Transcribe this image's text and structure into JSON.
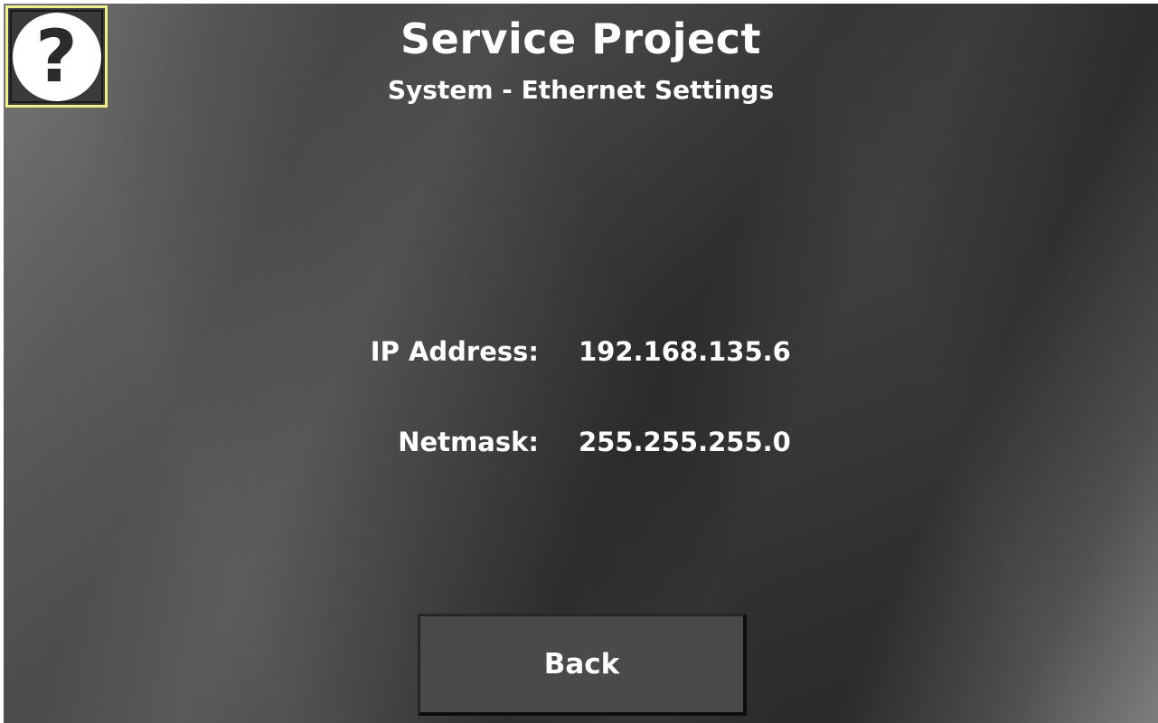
{
  "header": {
    "title": "Service Project",
    "subtitle": "System - Ethernet Settings"
  },
  "help_button": {
    "icon": "question-mark-icon",
    "glyph": "?"
  },
  "ethernet": {
    "ip_label": "IP Address:",
    "ip_value": "192.168.135.6",
    "netmask_label": "Netmask:",
    "netmask_value": "255.255.255.0"
  },
  "footer": {
    "back_label": "Back"
  },
  "colors": {
    "help_border": "#f0f08a",
    "text": "#ffffff",
    "button_bg": "#4a4a4a"
  }
}
